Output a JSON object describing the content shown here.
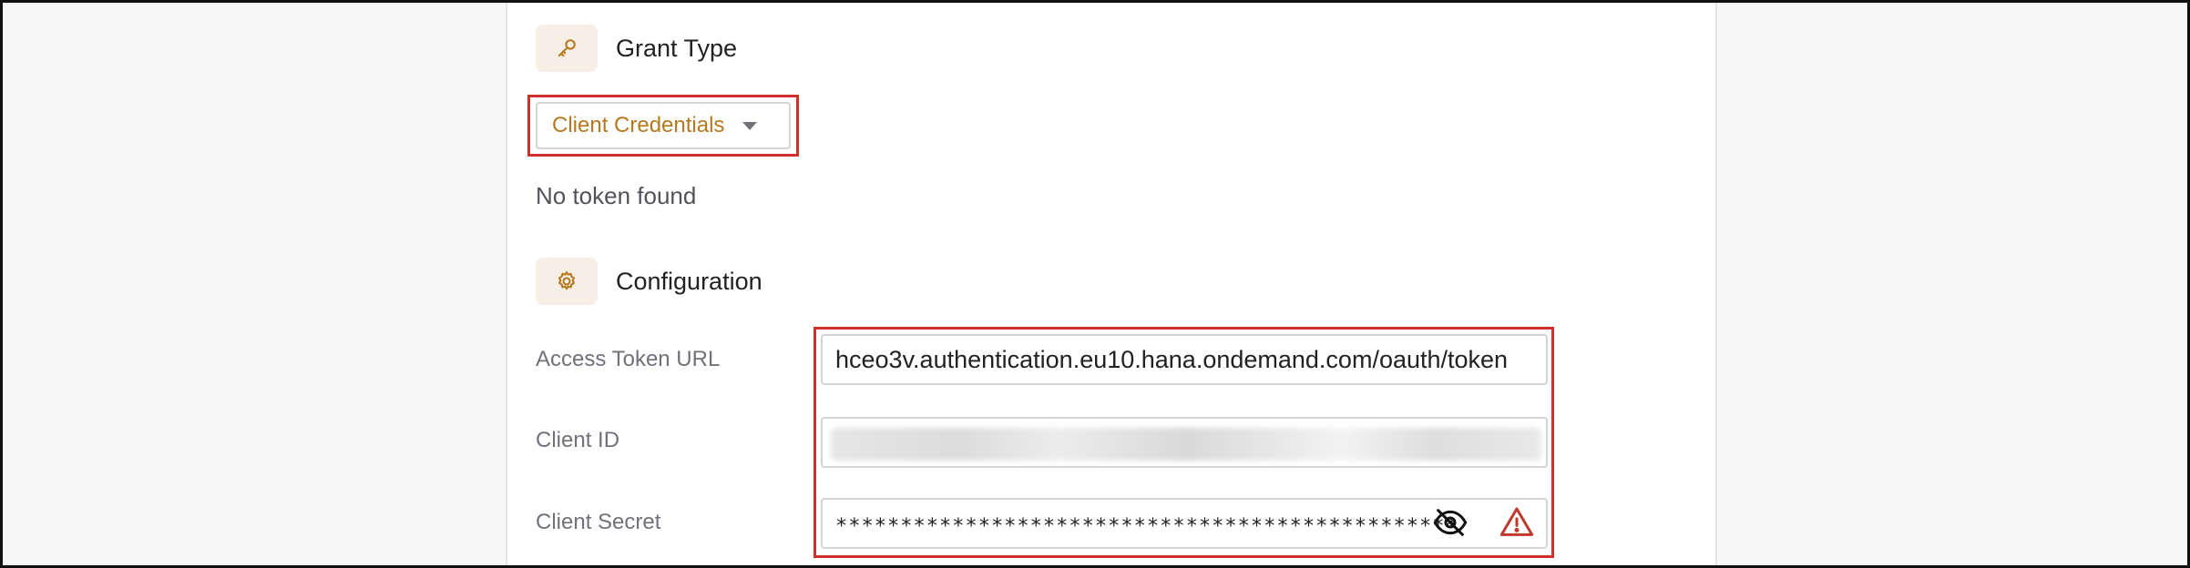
{
  "grant_type": {
    "icon": "key-icon",
    "title": "Grant Type",
    "selected": "Client Credentials"
  },
  "token_status": "No token found",
  "configuration": {
    "icon": "gear-icon",
    "title": "Configuration",
    "fields": {
      "access_token_url": {
        "label": "Access Token URL",
        "value": "hceo3v.authentication.eu10.hana.ondemand.com/oauth/token"
      },
      "client_id": {
        "label": "Client ID",
        "value": ""
      },
      "client_secret": {
        "label": "Client Secret",
        "value": "************************************************",
        "visibility_icon": "eye-slash-icon",
        "status_icon": "warning-icon"
      }
    }
  },
  "colors": {
    "accent": "#b7791f",
    "highlight": "#d0312d",
    "warning": "#c0392b"
  }
}
